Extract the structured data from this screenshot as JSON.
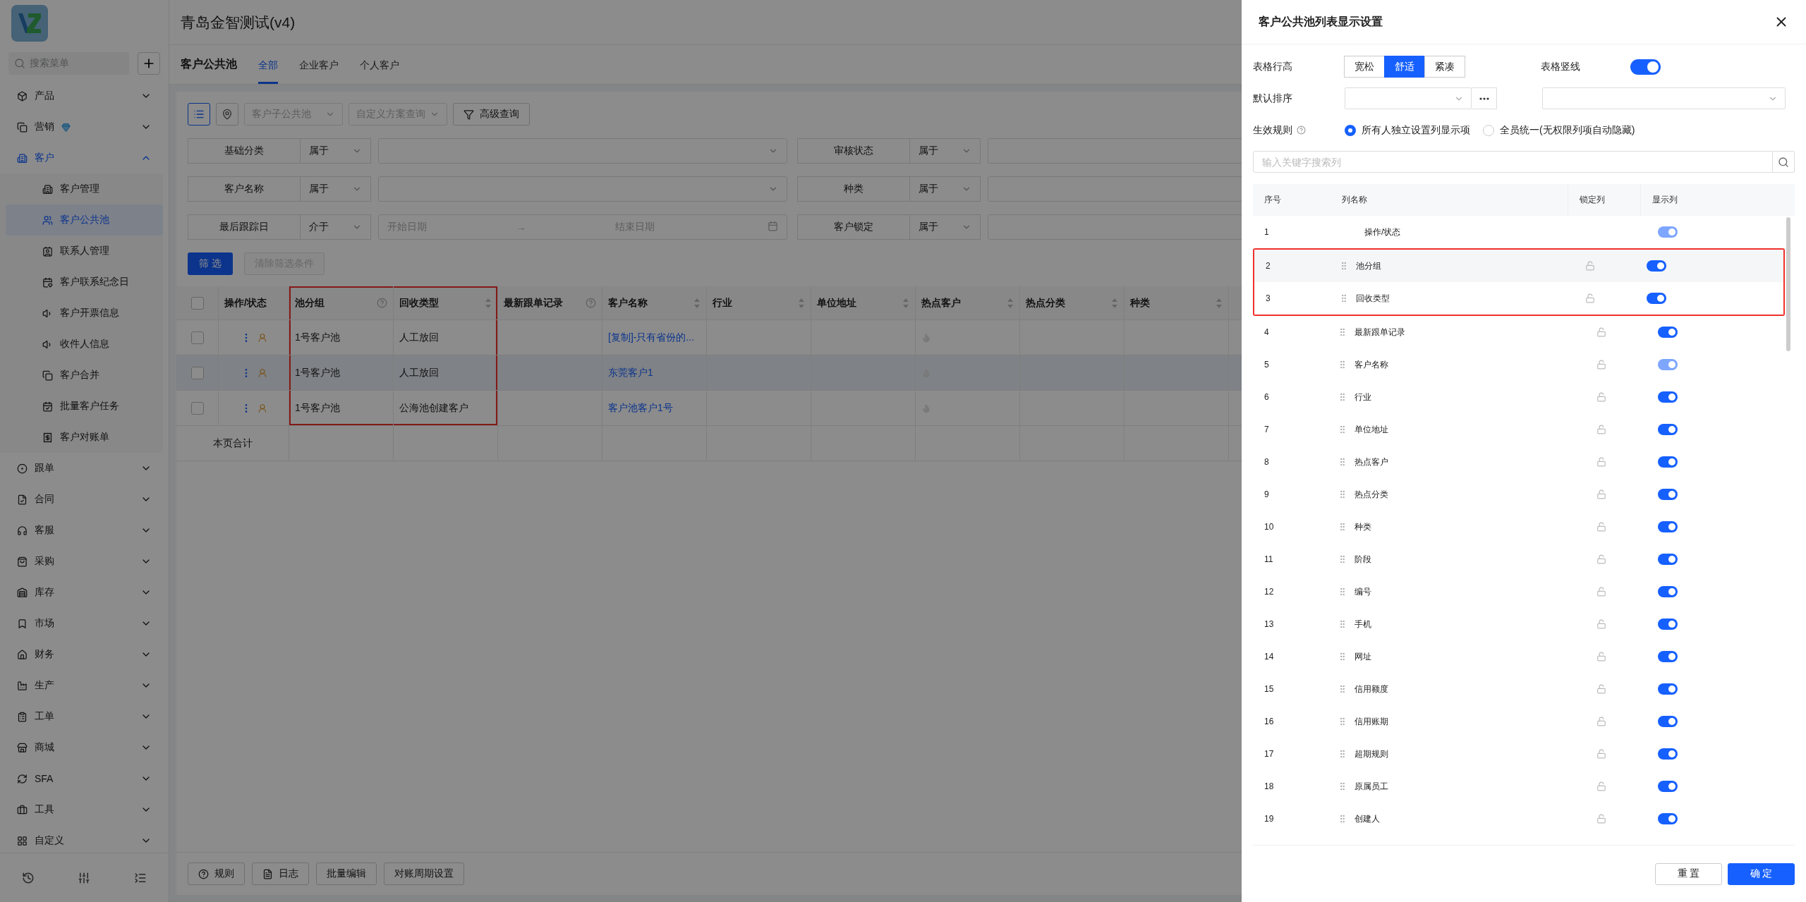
{
  "app": {
    "title": "青岛金智测试(v4)"
  },
  "sidebar": {
    "search_placeholder": "搜索菜单",
    "menu": [
      {
        "label": "产品",
        "expanded": false,
        "premium": false,
        "selected": false
      },
      {
        "label": "营销",
        "expanded": false,
        "premium": true,
        "selected": false
      },
      {
        "label": "客户",
        "expanded": true,
        "premium": false,
        "selected": true,
        "children": [
          {
            "label": "客户管理",
            "selected": false
          },
          {
            "label": "客户公共池",
            "selected": true
          },
          {
            "label": "联系人管理",
            "selected": false
          },
          {
            "label": "客户联系纪念日",
            "selected": false
          },
          {
            "label": "客户开票信息",
            "selected": false
          },
          {
            "label": "收件人信息",
            "selected": false
          },
          {
            "label": "客户合并",
            "selected": false
          },
          {
            "label": "批量客户任务",
            "selected": false
          },
          {
            "label": "客户对账单",
            "selected": false
          }
        ]
      },
      {
        "label": "跟单",
        "expanded": false,
        "premium": false,
        "selected": false
      },
      {
        "label": "合同",
        "expanded": false,
        "premium": false,
        "selected": false
      },
      {
        "label": "客服",
        "expanded": false,
        "premium": false,
        "selected": false
      },
      {
        "label": "采购",
        "expanded": false,
        "premium": false,
        "selected": false
      },
      {
        "label": "库存",
        "expanded": false,
        "premium": false,
        "selected": false
      },
      {
        "label": "市场",
        "expanded": false,
        "premium": false,
        "selected": false
      },
      {
        "label": "财务",
        "expanded": false,
        "premium": false,
        "selected": false
      },
      {
        "label": "生产",
        "expanded": false,
        "premium": false,
        "selected": false
      },
      {
        "label": "工单",
        "expanded": false,
        "premium": false,
        "selected": false
      },
      {
        "label": "商城",
        "expanded": false,
        "premium": false,
        "selected": false
      },
      {
        "label": "SFA",
        "expanded": false,
        "premium": false,
        "selected": false
      },
      {
        "label": "工具",
        "expanded": false,
        "premium": false,
        "selected": false
      },
      {
        "label": "自定义",
        "expanded": false,
        "premium": false,
        "selected": false
      }
    ]
  },
  "page": {
    "title": "客户公共池",
    "tabs": [
      {
        "label": "全部",
        "selected": true
      },
      {
        "label": "企业客户",
        "selected": false
      },
      {
        "label": "个人客户",
        "selected": false
      }
    ],
    "view_modes": [
      {
        "selected": true
      },
      {
        "selected": false
      }
    ],
    "dropdowns": [
      {
        "placeholder": "客户子公共池"
      },
      {
        "placeholder": "自定义方案查询"
      }
    ],
    "advanced_button": "高级查询",
    "filters": [
      {
        "field": "基础分类",
        "operator": "属于",
        "kind": "select"
      },
      {
        "field": "审核状态",
        "operator": "属于",
        "kind": "select"
      },
      {
        "field": "客户名称",
        "operator": "属于",
        "kind": "select"
      },
      {
        "field": "种类",
        "operator": "属于",
        "kind": "select"
      },
      {
        "field": "最后跟踪日",
        "operator": "介于",
        "kind": "date_range",
        "start_placeholder": "开始日期",
        "separator": "→",
        "end_placeholder": "结束日期"
      },
      {
        "field": "客户锁定",
        "operator": "属于",
        "kind": "select"
      }
    ],
    "filter_button": "筛 选",
    "clear_button": {
      "label": "清除筛选条件",
      "disabled": true
    },
    "table": {
      "all_checked": false,
      "columns": [
        {
          "label": "操作/状态",
          "help": false,
          "sortable": false,
          "highlighted": false
        },
        {
          "label": "池分组",
          "help": true,
          "sortable": false,
          "highlighted": true
        },
        {
          "label": "回收类型",
          "help": false,
          "sortable": true,
          "highlighted": true
        },
        {
          "label": "最新跟单记录",
          "help": true,
          "sortable": false,
          "highlighted": false
        },
        {
          "label": "客户名称",
          "help": false,
          "sortable": true,
          "highlighted": false
        },
        {
          "label": "行业",
          "help": false,
          "sortable": true,
          "highlighted": false
        },
        {
          "label": "单位地址",
          "help": false,
          "sortable": true,
          "highlighted": false
        },
        {
          "label": "热点客户",
          "help": false,
          "sortable": true,
          "highlighted": false
        },
        {
          "label": "热点分类",
          "help": false,
          "sortable": true,
          "highlighted": false
        },
        {
          "label": "种类",
          "help": false,
          "sortable": true,
          "highlighted": false
        }
      ],
      "rows": [
        {
          "checked": false,
          "hovered": false,
          "cells": [
            "",
            "1号客户池",
            "人工放回",
            "",
            "[复制]-只有省份的...",
            "",
            "",
            "",
            "",
            ""
          ],
          "hot": false
        },
        {
          "checked": false,
          "hovered": true,
          "cells": [
            "",
            "1号客户池",
            "人工放回",
            "",
            "东莞客户1",
            "",
            "",
            "",
            "",
            ""
          ],
          "hot": false
        },
        {
          "checked": false,
          "hovered": false,
          "cells": [
            "",
            "1号客户池",
            "公海池创建客户",
            "",
            "客户池客户1号",
            "",
            "",
            "",
            "",
            ""
          ],
          "hot": false
        }
      ],
      "footer_label": "本页合计"
    },
    "bottom_actions": [
      "规则",
      "日志",
      "批量编辑",
      "对账周期设置"
    ]
  },
  "drawer": {
    "title": "客户公共池列表显示设置",
    "row_height": {
      "label": "表格行高",
      "options": [
        {
          "label": "宽松",
          "selected": false
        },
        {
          "label": "舒适",
          "selected": true
        },
        {
          "label": "紧凑",
          "selected": false
        }
      ]
    },
    "vertical_lines": {
      "label": "表格竖线",
      "on": true
    },
    "default_sort": {
      "label": "默认排序"
    },
    "effect_rule": {
      "label": "生效规则",
      "options": [
        {
          "label": "所有人独立设置列显示项",
          "selected": true
        },
        {
          "label": "全员统一(无权限列项自动隐藏)",
          "selected": false
        }
      ]
    },
    "search": {
      "placeholder": "输入关键字搜索列"
    },
    "headers": [
      "序号",
      "列名称",
      "锁定列",
      "显示列"
    ],
    "rows": [
      {
        "index": "1",
        "name": "操作/状态",
        "kind": "fixed",
        "shown": true,
        "disabled": true,
        "hovered": false,
        "highlighted": false
      },
      {
        "index": "2",
        "name": "池分组",
        "kind": "movable",
        "locked": false,
        "shown": true,
        "disabled": false,
        "hovered": true,
        "highlighted": true
      },
      {
        "index": "3",
        "name": "回收类型",
        "kind": "movable",
        "locked": false,
        "shown": true,
        "disabled": false,
        "hovered": false,
        "highlighted": true
      },
      {
        "index": "4",
        "name": "最新跟单记录",
        "kind": "movable",
        "locked": false,
        "shown": true,
        "disabled": false,
        "hovered": false,
        "highlighted": false
      },
      {
        "index": "5",
        "name": "客户名称",
        "kind": "movable",
        "locked": false,
        "shown": true,
        "disabled": true,
        "hovered": false,
        "highlighted": false
      },
      {
        "index": "6",
        "name": "行业",
        "kind": "movable",
        "locked": false,
        "shown": true,
        "disabled": false,
        "hovered": false,
        "highlighted": false
      },
      {
        "index": "7",
        "name": "单位地址",
        "kind": "movable",
        "locked": false,
        "shown": true,
        "disabled": false,
        "hovered": false,
        "highlighted": false
      },
      {
        "index": "8",
        "name": "热点客户",
        "kind": "movable",
        "locked": false,
        "shown": true,
        "disabled": false,
        "hovered": false,
        "highlighted": false
      },
      {
        "index": "9",
        "name": "热点分类",
        "kind": "movable",
        "locked": false,
        "shown": true,
        "disabled": false,
        "hovered": false,
        "highlighted": false
      },
      {
        "index": "10",
        "name": "种类",
        "kind": "movable",
        "locked": false,
        "shown": true,
        "disabled": false,
        "hovered": false,
        "highlighted": false
      },
      {
        "index": "11",
        "name": "阶段",
        "kind": "movable",
        "locked": false,
        "shown": true,
        "disabled": false,
        "hovered": false,
        "highlighted": false
      },
      {
        "index": "12",
        "name": "编号",
        "kind": "movable",
        "locked": false,
        "shown": true,
        "disabled": false,
        "hovered": false,
        "highlighted": false
      },
      {
        "index": "13",
        "name": "手机",
        "kind": "movable",
        "locked": false,
        "shown": true,
        "disabled": false,
        "hovered": false,
        "highlighted": false
      },
      {
        "index": "14",
        "name": "网址",
        "kind": "movable",
        "locked": false,
        "shown": true,
        "disabled": false,
        "hovered": false,
        "highlighted": false
      },
      {
        "index": "15",
        "name": "信用额度",
        "kind": "movable",
        "locked": false,
        "shown": true,
        "disabled": false,
        "hovered": false,
        "highlighted": false
      },
      {
        "index": "16",
        "name": "信用账期",
        "kind": "movable",
        "locked": false,
        "shown": true,
        "disabled": false,
        "hovered": false,
        "highlighted": false
      },
      {
        "index": "17",
        "name": "超期规则",
        "kind": "movable",
        "locked": false,
        "shown": true,
        "disabled": false,
        "hovered": false,
        "highlighted": false
      },
      {
        "index": "18",
        "name": "原属员工",
        "kind": "movable",
        "locked": false,
        "shown": true,
        "disabled": false,
        "hovered": false,
        "highlighted": false
      },
      {
        "index": "19",
        "name": "创建人",
        "kind": "movable",
        "locked": false,
        "shown": true,
        "disabled": false,
        "hovered": false,
        "highlighted": false
      }
    ],
    "buttons": [
      "重 置",
      "确 定"
    ]
  }
}
